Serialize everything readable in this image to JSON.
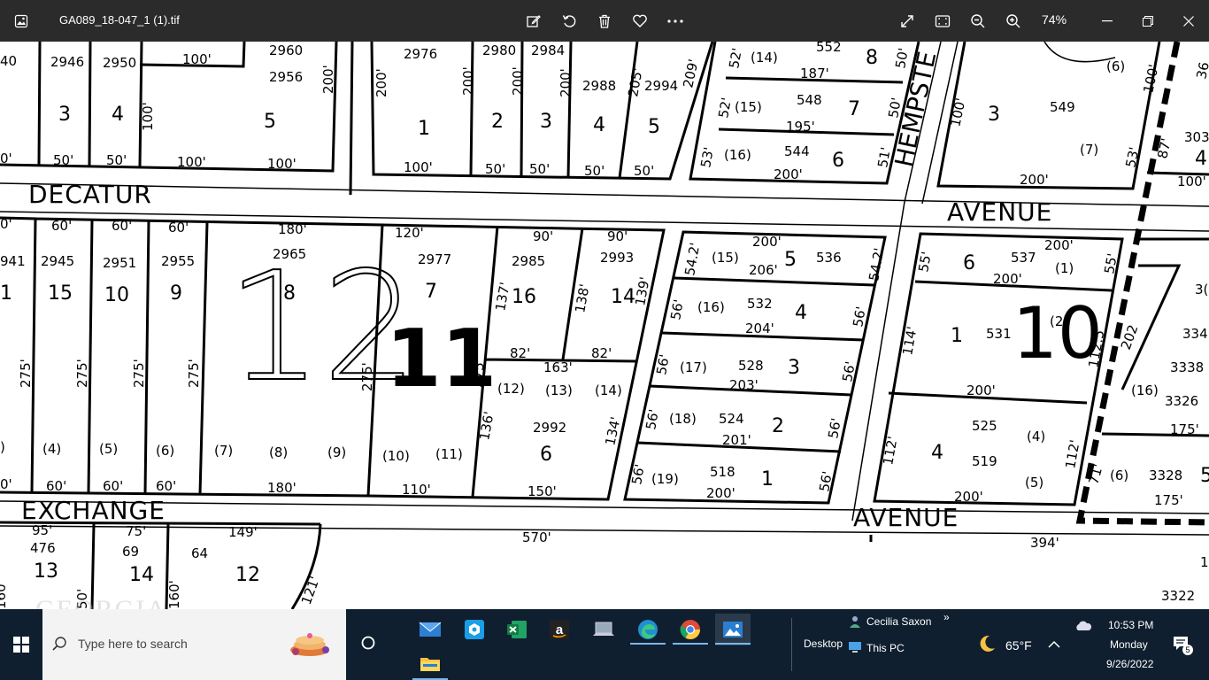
{
  "titlebar": {
    "filename": "GA089_18-047_1 (1).tif",
    "zoom": "74%",
    "icons": [
      "photos-app-icon",
      "edit-image-icon",
      "rotate-icon",
      "delete-icon",
      "favorite-heart-icon",
      "more-options-icon",
      "fullscreen-icon",
      "fit-window-icon",
      "zoom-out-icon",
      "zoom-in-icon",
      "minimize-icon",
      "restore-icon",
      "close-icon"
    ]
  },
  "map": {
    "streets": {
      "decatur": "DECATUR",
      "avenue_top": "AVENUE",
      "exchange": "EXCHANGE",
      "avenue_bottom": "AVENUE",
      "hempstead": "HEMPSTE"
    },
    "blocks": {
      "b12": "12",
      "b11": "11",
      "b10": "10"
    },
    "labels": [
      {
        "id": "t1",
        "text": "40"
      },
      {
        "id": "t2",
        "text": "2946"
      },
      {
        "id": "t3",
        "text": "2950"
      },
      {
        "id": "t4",
        "text": "100'"
      },
      {
        "id": "t5",
        "text": "2960"
      },
      {
        "id": "t6",
        "text": "2956"
      },
      {
        "id": "t7",
        "text": "200'"
      },
      {
        "id": "t8",
        "text": "3"
      },
      {
        "id": "t9",
        "text": "4"
      },
      {
        "id": "t10",
        "text": "100'"
      },
      {
        "id": "t11",
        "text": "5"
      },
      {
        "id": "t12",
        "text": "50'"
      },
      {
        "id": "t13",
        "text": "50'"
      },
      {
        "id": "t14",
        "text": "100'"
      },
      {
        "id": "t15",
        "text": "100'"
      },
      {
        "id": "t16",
        "text": "0'"
      },
      {
        "id": "t17",
        "text": "2976"
      },
      {
        "id": "t18",
        "text": "2980"
      },
      {
        "id": "t19",
        "text": "2984"
      },
      {
        "id": "t20",
        "text": "200'"
      },
      {
        "id": "t21",
        "text": "200'"
      },
      {
        "id": "t22",
        "text": "200'"
      },
      {
        "id": "t23",
        "text": "200'"
      },
      {
        "id": "t24",
        "text": "2988"
      },
      {
        "id": "t25",
        "text": "205'"
      },
      {
        "id": "t26",
        "text": "2994"
      },
      {
        "id": "t27",
        "text": "209'"
      },
      {
        "id": "t28",
        "text": "1"
      },
      {
        "id": "t29",
        "text": "2"
      },
      {
        "id": "t30",
        "text": "3"
      },
      {
        "id": "t31",
        "text": "4"
      },
      {
        "id": "t32",
        "text": "5"
      },
      {
        "id": "t33",
        "text": "100'"
      },
      {
        "id": "t34",
        "text": "50'"
      },
      {
        "id": "t35",
        "text": "50'"
      },
      {
        "id": "t36",
        "text": "50'"
      },
      {
        "id": "t37",
        "text": "50'"
      },
      {
        "id": "t38",
        "text": "52'"
      },
      {
        "id": "t39",
        "text": "(14)"
      },
      {
        "id": "t40",
        "text": "552"
      },
      {
        "id": "t41",
        "text": "8"
      },
      {
        "id": "t42",
        "text": "50'"
      },
      {
        "id": "t43",
        "text": "187'"
      },
      {
        "id": "t44",
        "text": "52'"
      },
      {
        "id": "t45",
        "text": "(15)"
      },
      {
        "id": "t46",
        "text": "548"
      },
      {
        "id": "t47",
        "text": "7"
      },
      {
        "id": "t48",
        "text": "50'"
      },
      {
        "id": "t49",
        "text": "195'"
      },
      {
        "id": "t50",
        "text": "53'"
      },
      {
        "id": "t51",
        "text": "(16)"
      },
      {
        "id": "t52",
        "text": "544"
      },
      {
        "id": "t53",
        "text": "6"
      },
      {
        "id": "t54",
        "text": "51'"
      },
      {
        "id": "t55",
        "text": "200'"
      },
      {
        "id": "t56",
        "text": "(6)"
      },
      {
        "id": "t57",
        "text": "100'"
      },
      {
        "id": "t58",
        "text": "3"
      },
      {
        "id": "t59",
        "text": "549"
      },
      {
        "id": "t60",
        "text": "100'"
      },
      {
        "id": "t61",
        "text": "(7)"
      },
      {
        "id": "t62",
        "text": "53'"
      },
      {
        "id": "t63",
        "text": "200'"
      },
      {
        "id": "t64",
        "text": "87'"
      },
      {
        "id": "t65",
        "text": "303"
      },
      {
        "id": "t66",
        "text": "4"
      },
      {
        "id": "t67",
        "text": "100'"
      },
      {
        "id": "t68",
        "text": "36"
      },
      {
        "id": "t69",
        "text": "0'"
      },
      {
        "id": "t70",
        "text": "60'"
      },
      {
        "id": "t71",
        "text": "60'"
      },
      {
        "id": "t72",
        "text": "60'"
      },
      {
        "id": "t73",
        "text": "180'"
      },
      {
        "id": "t74",
        "text": "120'"
      },
      {
        "id": "t75",
        "text": "90'"
      },
      {
        "id": "t76",
        "text": "90'"
      },
      {
        "id": "t77",
        "text": "941"
      },
      {
        "id": "t78",
        "text": "2945"
      },
      {
        "id": "t79",
        "text": "2951"
      },
      {
        "id": "t80",
        "text": "2955"
      },
      {
        "id": "t81",
        "text": "2965"
      },
      {
        "id": "t82",
        "text": "2977"
      },
      {
        "id": "t83",
        "text": "2985"
      },
      {
        "id": "t84",
        "text": "2993"
      },
      {
        "id": "t85",
        "text": "1"
      },
      {
        "id": "t86",
        "text": "15"
      },
      {
        "id": "t87",
        "text": "10"
      },
      {
        "id": "t88",
        "text": "9"
      },
      {
        "id": "t89",
        "text": "8"
      },
      {
        "id": "t90",
        "text": "7"
      },
      {
        "id": "t91",
        "text": "16"
      },
      {
        "id": "t92",
        "text": "14"
      },
      {
        "id": "t93",
        "text": "137'"
      },
      {
        "id": "t94",
        "text": "138'"
      },
      {
        "id": "t95",
        "text": "139'"
      },
      {
        "id": "t96",
        "text": "275'"
      },
      {
        "id": "t97",
        "text": "275'"
      },
      {
        "id": "t98",
        "text": "275'"
      },
      {
        "id": "t99",
        "text": "275'"
      },
      {
        "id": "t100",
        "text": "275'"
      },
      {
        "id": "t101",
        "text": "275'"
      },
      {
        "id": "t102",
        "text": "82'"
      },
      {
        "id": "t103",
        "text": "82'"
      },
      {
        "id": "t104",
        "text": "163'"
      },
      {
        "id": "t105",
        "text": "(12)"
      },
      {
        "id": "t106",
        "text": "(13)"
      },
      {
        "id": "t107",
        "text": "(14)"
      },
      {
        "id": "t108",
        "text": "136'"
      },
      {
        "id": "t109",
        "text": "2992"
      },
      {
        "id": "t110",
        "text": "134'"
      },
      {
        "id": "t111",
        "text": "6"
      },
      {
        "id": "t112",
        "text": ")"
      },
      {
        "id": "t113",
        "text": "(4)"
      },
      {
        "id": "t114",
        "text": "(5)"
      },
      {
        "id": "t115",
        "text": "(6)"
      },
      {
        "id": "t116",
        "text": "(7)"
      },
      {
        "id": "t117",
        "text": "(8)"
      },
      {
        "id": "t118",
        "text": "(9)"
      },
      {
        "id": "t119",
        "text": "(10)"
      },
      {
        "id": "t120",
        "text": "(11)"
      },
      {
        "id": "t121",
        "text": "0'"
      },
      {
        "id": "t122",
        "text": "60'"
      },
      {
        "id": "t123",
        "text": "60'"
      },
      {
        "id": "t124",
        "text": "60'"
      },
      {
        "id": "t125",
        "text": "180'"
      },
      {
        "id": "t126",
        "text": "110'"
      },
      {
        "id": "t127",
        "text": "150'"
      },
      {
        "id": "t128",
        "text": "54.2'"
      },
      {
        "id": "t129",
        "text": "200'"
      },
      {
        "id": "t130",
        "text": "(15)"
      },
      {
        "id": "t131",
        "text": "206'"
      },
      {
        "id": "t132",
        "text": "5"
      },
      {
        "id": "t133",
        "text": "536"
      },
      {
        "id": "t134",
        "text": "54.2'"
      },
      {
        "id": "t135",
        "text": "56'"
      },
      {
        "id": "t136",
        "text": "(16)"
      },
      {
        "id": "t137",
        "text": "532"
      },
      {
        "id": "t138",
        "text": "4"
      },
      {
        "id": "t139",
        "text": "204'"
      },
      {
        "id": "t140",
        "text": "56'"
      },
      {
        "id": "t141",
        "text": "56'"
      },
      {
        "id": "t142",
        "text": "(17)"
      },
      {
        "id": "t143",
        "text": "528"
      },
      {
        "id": "t144",
        "text": "3"
      },
      {
        "id": "t145",
        "text": "203'"
      },
      {
        "id": "t146",
        "text": "56'"
      },
      {
        "id": "t147",
        "text": "56'"
      },
      {
        "id": "t148",
        "text": "(18)"
      },
      {
        "id": "t149",
        "text": "524"
      },
      {
        "id": "t150",
        "text": "2"
      },
      {
        "id": "t151",
        "text": "201'"
      },
      {
        "id": "t152",
        "text": "56'"
      },
      {
        "id": "t153",
        "text": "56'"
      },
      {
        "id": "t154",
        "text": "(19)"
      },
      {
        "id": "t155",
        "text": "518"
      },
      {
        "id": "t156",
        "text": "1"
      },
      {
        "id": "t157",
        "text": "200'"
      },
      {
        "id": "t158",
        "text": "56'"
      },
      {
        "id": "t159",
        "text": "55'"
      },
      {
        "id": "t160",
        "text": "6"
      },
      {
        "id": "t161",
        "text": "537"
      },
      {
        "id": "t162",
        "text": "200'"
      },
      {
        "id": "t163",
        "text": "(1)"
      },
      {
        "id": "t164",
        "text": "55'"
      },
      {
        "id": "t165",
        "text": "200'"
      },
      {
        "id": "t166",
        "text": "114'"
      },
      {
        "id": "t167",
        "text": "1"
      },
      {
        "id": "t168",
        "text": "531"
      },
      {
        "id": "t169",
        "text": "(2)"
      },
      {
        "id": "t170",
        "text": "112.5"
      },
      {
        "id": "t171",
        "text": "202"
      },
      {
        "id": "t172",
        "text": "200'"
      },
      {
        "id": "t173",
        "text": "3("
      },
      {
        "id": "t174",
        "text": "334"
      },
      {
        "id": "t175",
        "text": "3338"
      },
      {
        "id": "t176",
        "text": "(16)"
      },
      {
        "id": "t177",
        "text": "3326"
      },
      {
        "id": "t178",
        "text": "175'"
      },
      {
        "id": "t179",
        "text": "112'"
      },
      {
        "id": "t180",
        "text": "4"
      },
      {
        "id": "t181",
        "text": "525"
      },
      {
        "id": "t182",
        "text": "(4)"
      },
      {
        "id": "t183",
        "text": "519"
      },
      {
        "id": "t184",
        "text": "(5)"
      },
      {
        "id": "t185",
        "text": "112'"
      },
      {
        "id": "t186",
        "text": "200'"
      },
      {
        "id": "t187",
        "text": "71'"
      },
      {
        "id": "t188",
        "text": "(6)"
      },
      {
        "id": "t189",
        "text": "3328"
      },
      {
        "id": "t190",
        "text": "5"
      },
      {
        "id": "t191",
        "text": "175'"
      },
      {
        "id": "t192",
        "text": "95'"
      },
      {
        "id": "t193",
        "text": "476"
      },
      {
        "id": "t194",
        "text": "13"
      },
      {
        "id": "t195",
        "text": "75'"
      },
      {
        "id": "t196",
        "text": "69"
      },
      {
        "id": "t197",
        "text": "14"
      },
      {
        "id": "t198",
        "text": "149'"
      },
      {
        "id": "t199",
        "text": "64"
      },
      {
        "id": "t200",
        "text": "12"
      },
      {
        "id": "t201",
        "text": "570'"
      },
      {
        "id": "t202",
        "text": "394'"
      },
      {
        "id": "t203",
        "text": "3322"
      },
      {
        "id": "t204",
        "text": "160'"
      },
      {
        "id": "t205",
        "text": "50'"
      },
      {
        "id": "t206",
        "text": "160'"
      },
      {
        "id": "t207",
        "text": "121'"
      },
      {
        "id": "t208",
        "text": "16"
      }
    ]
  },
  "watermark": "GEORGIA",
  "taskbar": {
    "search_placeholder": "Type here to search",
    "user_name": "Cecilia Saxon",
    "this_pc": "This PC",
    "desktop": "Desktop",
    "weather": "65°F",
    "time": "10:53 PM",
    "day": "Monday",
    "date": "9/26/2022",
    "notifications": "5",
    "apps": [
      "start-icon",
      "search-icon",
      "search-highlight-icon",
      "cortana-icon",
      "mail-icon",
      "app-icon",
      "excel-icon",
      "amazon-icon",
      "laptop-icon",
      "edge-icon",
      "chrome-icon",
      "photos-icon",
      "file-explorer-icon"
    ]
  }
}
